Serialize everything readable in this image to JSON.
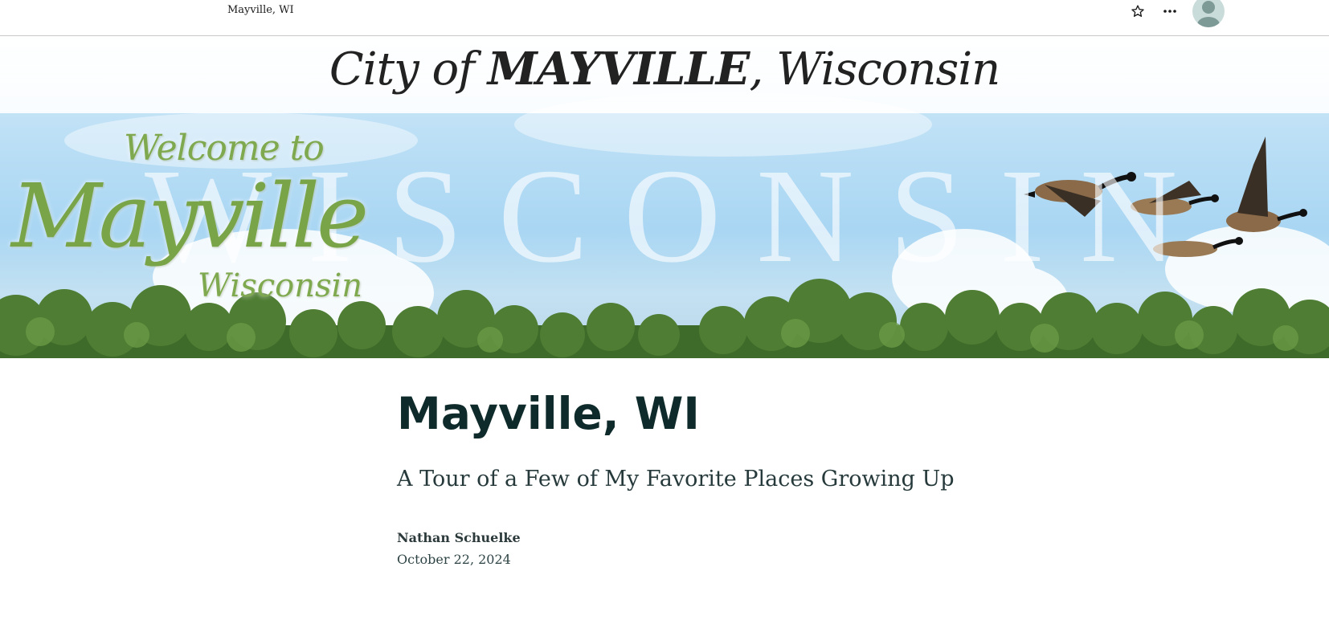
{
  "topbar": {
    "title": "Mayville, WI",
    "icons": [
      "star-icon",
      "more-options-icon",
      "user-avatar-icon"
    ]
  },
  "banner": {
    "city_prefix": "City of ",
    "city_name": "MAYVILLE",
    "city_suffix": ", Wisconsin",
    "background_word": "WISCONSIN",
    "welcome_to": "Welcome to",
    "welcome_name": "Mayville",
    "welcome_state": "Wisconsin"
  },
  "article": {
    "title": "Mayville, WI",
    "subtitle": "A Tour of a Few of My Favorite Places Growing Up",
    "author": "Nathan Schuelke",
    "date": "October 22, 2024"
  },
  "colors": {
    "title_text": "#0f2a2a",
    "avatar_bg": "#c9dcd9",
    "welcome_green": "#7fa94e",
    "sky_blue": "#a9d6f3"
  }
}
